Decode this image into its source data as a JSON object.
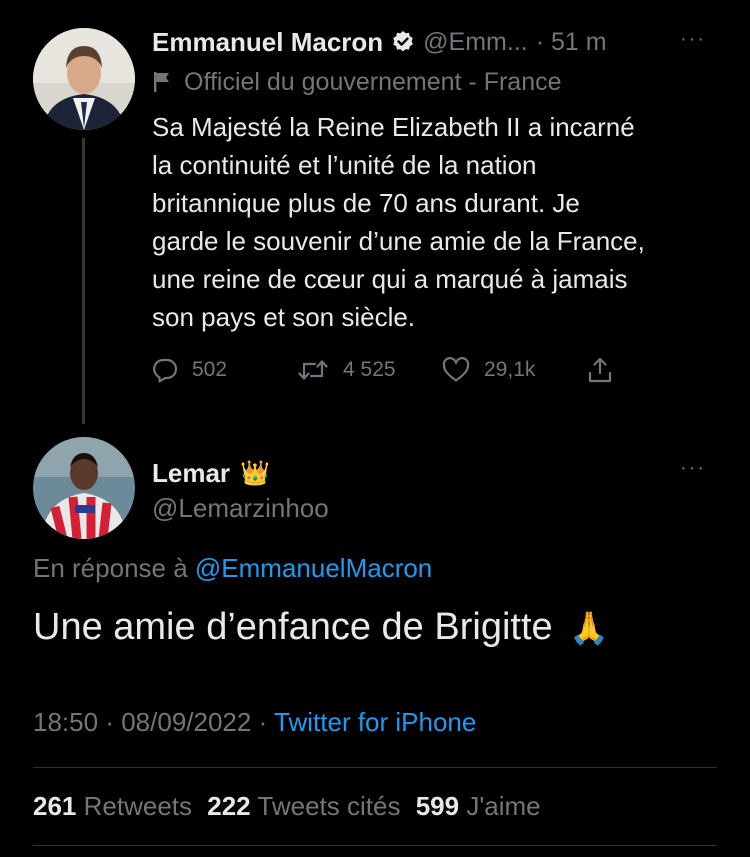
{
  "original_tweet": {
    "author_name": "Emmanuel Macron",
    "author_handle": "@Emm...",
    "time_ago": "· 51 m",
    "more": "···",
    "government_label": "Officiel du gouvernement - France",
    "text_lines": [
      "Sa Majesté la Reine Elizabeth II a incarné",
      "la continuité et l’unité de la nation",
      "britannique plus de 70 ans durant. Je",
      "garde le souvenir d’une amie de la France,",
      "une reine de cœur qui a marqué à jamais",
      "son pays et son siècle."
    ],
    "actions": {
      "replies": "502",
      "retweets": "4 525",
      "likes": "29,1k"
    },
    "icons": [
      "verified-badge-icon",
      "flag-icon",
      "reply-icon",
      "retweet-icon",
      "like-icon",
      "share-icon"
    ]
  },
  "reply_tweet": {
    "author_name": "Lemar",
    "author_emoji": "👑",
    "author_handle": "@Lemarzinhoo",
    "more": "···",
    "in_reply_prefix": "En réponse à",
    "in_reply_handle": "@EmmanuelMacron",
    "text": "Une amie d’enfance de Brigitte",
    "text_emoji": "🙏",
    "time": "18:50",
    "sep1": "·",
    "date": "08/09/2022",
    "sep2": "·",
    "source": "Twitter for iPhone",
    "stats": {
      "retweets_count": "261",
      "retweets_label": "Retweets",
      "quotes_count": "222",
      "quotes_label": "Tweets cités",
      "likes_count": "599",
      "likes_label": "J'aime"
    }
  },
  "colors": {
    "background": "#000000",
    "text": "#e7e9ea",
    "secondary": "#71767b",
    "link": "#1d9bf0",
    "divider": "#2f3336"
  }
}
